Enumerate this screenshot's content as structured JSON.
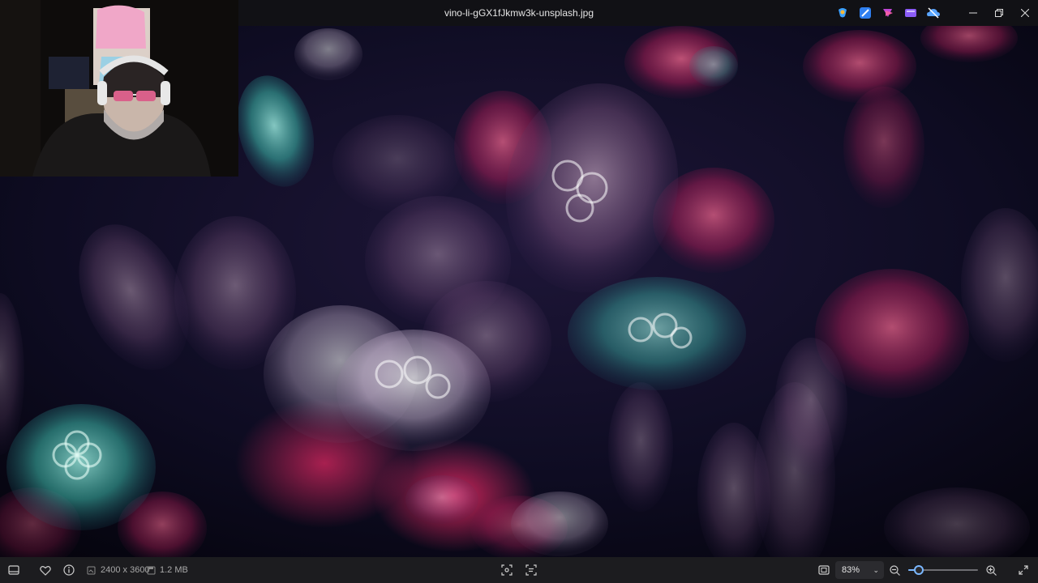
{
  "window": {
    "title": "vino-li-gGX1fJkmw3k-unsplash.jpg",
    "app_icons": [
      {
        "name": "copilot-icon",
        "color": "#3aa0ff"
      },
      {
        "name": "designer-icon",
        "color": "#2f7ff0"
      },
      {
        "name": "clipchamp-icon",
        "color": "#c046d6"
      },
      {
        "name": "tv-icon",
        "color": "#8b5cf6"
      },
      {
        "name": "onedrive-offline-icon",
        "color": "#5aa5ff"
      }
    ],
    "controls": [
      "minimize-icon",
      "restore-icon",
      "close-icon"
    ]
  },
  "image_info": {
    "dimensions": "2400 x 3600",
    "file_size": "1.2 MB"
  },
  "zoom": {
    "value": "83%",
    "slider_fraction": 0.15
  },
  "accent_color": "#7ab7ff"
}
